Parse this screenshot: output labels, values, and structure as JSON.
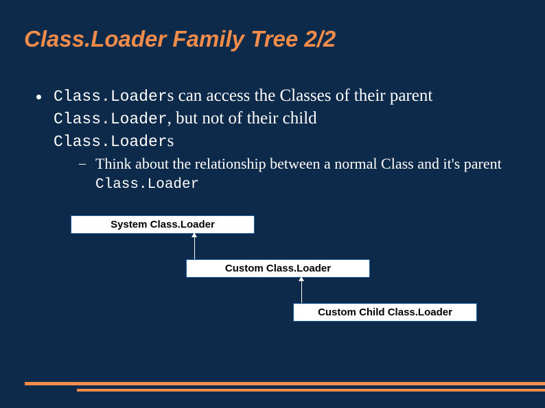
{
  "title": "Class.Loader Family Tree 2/2",
  "bullet": {
    "cl1": "Class.Loader",
    "t1": "s can access the Classes of their parent ",
    "cl2": "Class.Loader",
    "t2": ", but not of their child",
    "cl3": "Class.Loader",
    "t3": "s"
  },
  "sub": {
    "dash": "–",
    "t1": "Think about the relationship between a normal Class and it's parent ",
    "cl": "Class.Loader"
  },
  "diagram": {
    "box1": "System Class.Loader",
    "box2": "Custom Class.Loader",
    "box3": "Custom Child Class.Loader"
  }
}
